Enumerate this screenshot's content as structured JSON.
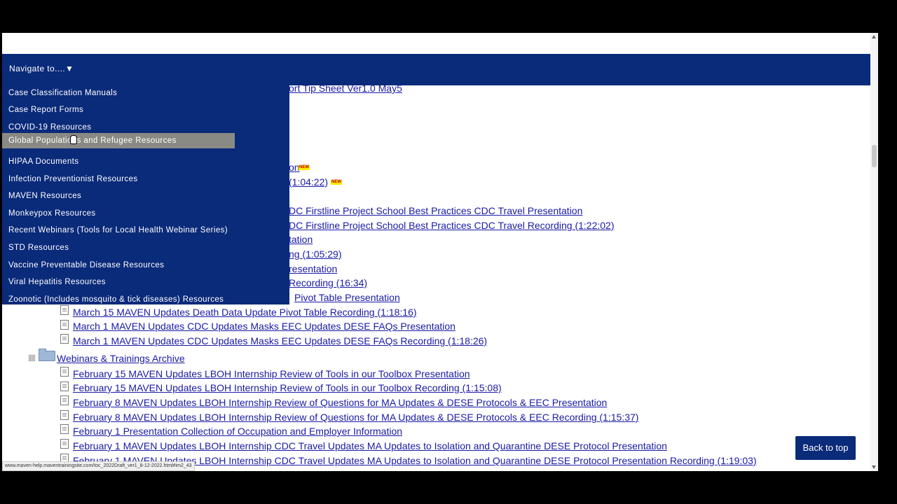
{
  "nav": {
    "toggle_label": "Navigate to....",
    "toggle_arrow": "▼",
    "items": [
      "Case Classification Manuals",
      "Case Report Forms",
      "COVID-19 Resources",
      "Global Populations and Refugee Resources",
      "HIPAA Documents",
      "Infection Preventionist Resources",
      "MAVEN Resources",
      "Monkeypox Resources",
      "Recent Webinars (Tools for Local Health Webinar Series)",
      "STD Resources",
      "Vaccine Preventable Disease Resources",
      "Viral Hepatitis Resources",
      "Zoonotic (Includes mosquito & tick diseases) Resources"
    ],
    "active_index": 3
  },
  "partial_links": [
    "ort Tip Sheet  Ver1.0  May5",
    "on",
    "(1:04:22)",
    "DC Firstline Project  School Best Practices  CDC Travel Presentation",
    "DC Firstline Project  School Best Practices  CDC Travel Recording (1:22:02)",
    "tation",
    "ng (1:05:29)",
    "resentation",
    "Recording (16:34)",
    "Pivot Table Presentation"
  ],
  "badges": [
    "NEW",
    "NEW"
  ],
  "links_before_folder": [
    "March 15  MAVEN Updates  Death Data Update  Pivot Table Recording (1:18:16)",
    "March 1  MAVEN Updates  CDC Updates  Masks  EEC Updates  DESE FAQs Presentation",
    "March 1  MAVEN Updates  CDC Updates  Masks  EEC Updates  DESE FAQs Recording (1:18:26)"
  ],
  "folder": {
    "label": "Webinars & Trainings Archive",
    "collapse_symbol": "⊟",
    "links": [
      "February 15  MAVEN Updates  LBOH Internship  Review of Tools in our Toolbox Presentation",
      "February 15  MAVEN Updates  LBOH Internship  Review of Tools in our Toolbox Recording (1:15:08)",
      "February 8  MAVEN Updates  LBOH Internship  Review of Questions for MA Updates & DESE Protocols & EEC Presentation",
      "February 8  MAVEN Updates  LBOH Internship  Review of Questions for MA Updates & DESE Protocols & EEC Recording (1:15:37)",
      "February 1  Presentation  Collection of Occupation and Employer Information",
      "February 1  MAVEN Updates  LBOH Internship  CDC Travel Updates   MA Updates to Isolation and Quarantine  DESE Protocol Presentation",
      "February 1  MAVEN Updates  LBOH Internship  CDC Travel Updates   MA Updates to Isolation and Quarantine  DESE Protocol Presentation Recording (1:19:03)"
    ]
  },
  "back_to_top_label": "Back to top",
  "status_url": "www.maven-help.maventrainingsite.com/toc_2022Draft_ver1_8-12-2022.html#im2_43",
  "colors": {
    "nav_bg": "#0a2a7a",
    "active_item": "#8a8a84",
    "link": "#1a1aa6"
  }
}
